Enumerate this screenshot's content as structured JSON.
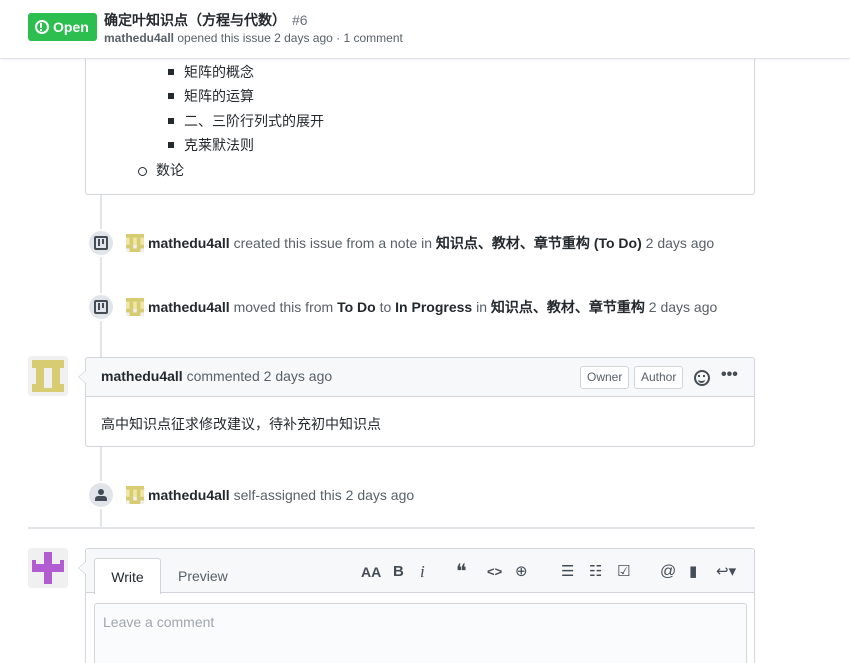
{
  "issue": {
    "state": "Open",
    "title": "确定叶知识点（方程与代数）",
    "number": "#6",
    "author": "mathedu4all",
    "meta_rest": "opened this issue 2 days ago · 1 comment"
  },
  "body": {
    "sub_items": [
      "矩阵的概念",
      "矩阵的运算",
      "二、三阶行列式的展开",
      "克莱默法则"
    ],
    "item": "数论"
  },
  "events": [
    {
      "actor": "mathedu4all",
      "text1": "created this issue from a note in",
      "project": "知识点、教材、章节重构",
      "column": "(To Do)",
      "time": "2 days ago"
    },
    {
      "actor": "mathedu4all",
      "text1": "moved this from",
      "from": "To Do",
      "text2": "to",
      "to": "In Progress",
      "text3": "in",
      "project": "知识点、教材、章节重构",
      "time": "2 days ago"
    },
    {
      "actor": "mathedu4all",
      "text1": "self-assigned this",
      "time": "2 days ago"
    }
  ],
  "comment": {
    "author": "mathedu4all",
    "action": "commented",
    "time": "2 days ago",
    "labels": [
      "Owner",
      "Author"
    ],
    "body": "高中知识点征求修改建议，待补充初中知识点"
  },
  "form": {
    "tab_write": "Write",
    "tab_preview": "Preview",
    "placeholder": "Leave a comment",
    "tools": {
      "heading": "AA",
      "bold": "B",
      "italic": "i",
      "quote": "❝",
      "code": "<>",
      "link": "⊕",
      "ul": "☰",
      "ol": "☷",
      "tasks": "☑",
      "mention": "@",
      "bookmark": "▮",
      "reply": "↩▾"
    }
  },
  "colors": {
    "open": "#2cbe4e",
    "avatar_yellow": "#d8cc72",
    "avatar_purple": "#b25cd1"
  }
}
